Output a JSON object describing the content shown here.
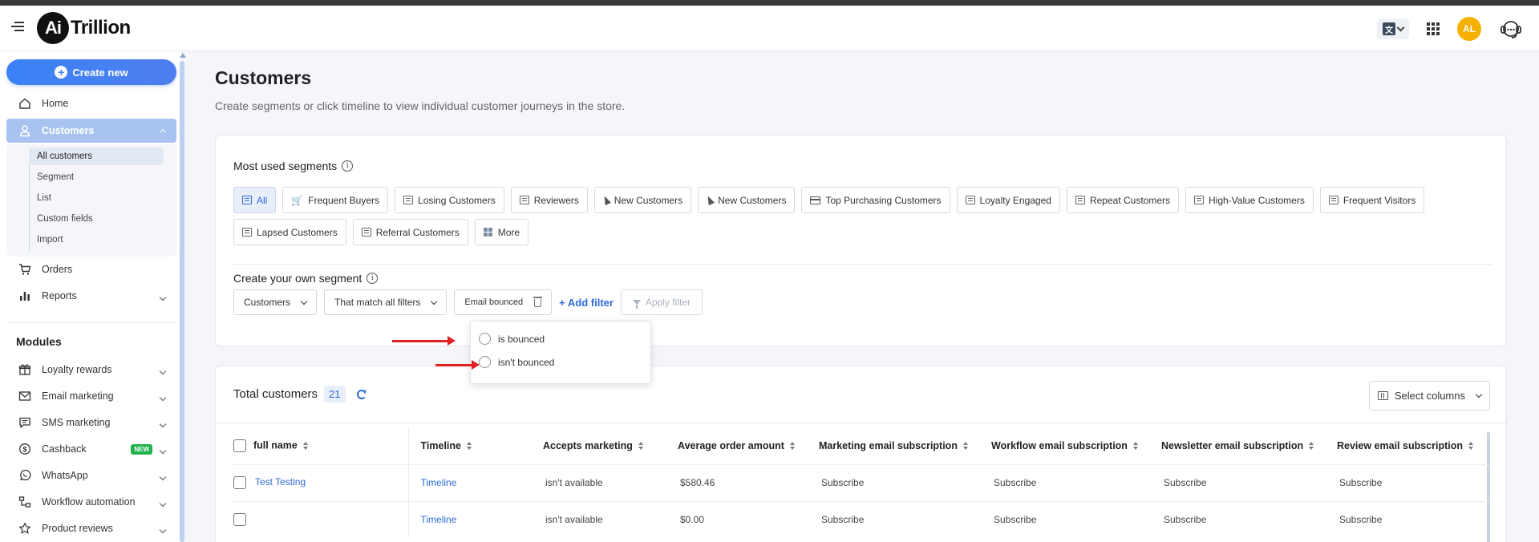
{
  "app": {
    "brand_mark": "Ai",
    "brand_text": "Trillion",
    "avatar_initials": "AL"
  },
  "sidebar": {
    "create_new": "Create new",
    "nav": [
      {
        "label": "Home",
        "icon": "home-icon"
      },
      {
        "label": "Customers",
        "icon": "user-icon",
        "active": true
      },
      {
        "label": "Orders",
        "icon": "cart-icon"
      },
      {
        "label": "Reports",
        "icon": "bar-chart-icon"
      }
    ],
    "customers_sub": [
      {
        "label": "All customers",
        "active": true
      },
      {
        "label": "Segment"
      },
      {
        "label": "List"
      },
      {
        "label": "Custom fields"
      },
      {
        "label": "Import"
      }
    ],
    "modules_title": "Modules",
    "modules": [
      {
        "label": "Loyalty rewards",
        "icon": "gift-icon"
      },
      {
        "label": "Email marketing",
        "icon": "mail-icon"
      },
      {
        "label": "SMS marketing",
        "icon": "chat-icon"
      },
      {
        "label": "Cashback",
        "icon": "dollar-icon",
        "badge": "NEW"
      },
      {
        "label": "WhatsApp",
        "icon": "whatsapp-icon"
      },
      {
        "label": "Workflow automation",
        "icon": "workflow-icon"
      },
      {
        "label": "Product reviews",
        "icon": "star-icon"
      }
    ]
  },
  "page": {
    "title": "Customers",
    "subtitle": "Create segments or click timeline to view individual customer journeys in the store."
  },
  "segments": {
    "title": "Most used segments",
    "chips": [
      {
        "label": "All",
        "icon": "segment-icon",
        "active": true
      },
      {
        "label": "Frequent Buyers",
        "icon": "cart-icon"
      },
      {
        "label": "Losing Customers",
        "icon": "segment-icon"
      },
      {
        "label": "Reviewers",
        "icon": "segment-icon"
      },
      {
        "label": "New Customers",
        "icon": "cursor-icon"
      },
      {
        "label": "New Customers",
        "icon": "cursor-icon"
      },
      {
        "label": "Top Purchasing Customers",
        "icon": "credit-card-icon"
      },
      {
        "label": "Loyalty Engaged",
        "icon": "segment-icon"
      },
      {
        "label": "Repeat Customers",
        "icon": "segment-icon"
      },
      {
        "label": "High-Value Customers",
        "icon": "segment-icon"
      },
      {
        "label": "Frequent Visitors",
        "icon": "segment-icon"
      },
      {
        "label": "Lapsed Customers",
        "icon": "segment-icon"
      },
      {
        "label": "Referral Customers",
        "icon": "segment-icon"
      },
      {
        "label": "More",
        "icon": "grid-icon"
      }
    ]
  },
  "own_segment": {
    "title": "Create your own segment",
    "entity_select": "Customers",
    "match_select": "That match all filters",
    "filter_pill": "Email bounced",
    "add_filter": "+ Add filter",
    "apply_filter": "Apply filter",
    "options": [
      "is bounced",
      "isn't bounced"
    ]
  },
  "customers_table": {
    "title": "Total customers",
    "count": "21",
    "select_columns": "Select columns",
    "headers": [
      "full name",
      "Timeline",
      "Accepts marketing",
      "Average order amount",
      "Marketing email subscription",
      "Workflow email subscription",
      "Newsletter email subscription",
      "Review email subscription"
    ],
    "rows": [
      {
        "name": "Test Testing",
        "timeline": "Timeline",
        "accepts": "isn't available",
        "avg": "$580.46",
        "marketing": "Subscribe",
        "workflow": "Subscribe",
        "newsletter": "Subscribe",
        "review": "Subscribe"
      },
      {
        "name": "",
        "timeline": "Timeline",
        "accepts": "isn't available",
        "avg": "$0.00",
        "marketing": "Subscribe",
        "workflow": "Subscribe",
        "newsletter": "Subscribe",
        "review": "Subscribe"
      }
    ]
  },
  "colors": {
    "accent": "#2e6ad6",
    "primary_button": "#3b82f6",
    "sidebar_active": "#a9c3f0",
    "avatar": "#f5b000",
    "annotation_arrow": "#e32020",
    "badge_new": "#22b24c"
  }
}
